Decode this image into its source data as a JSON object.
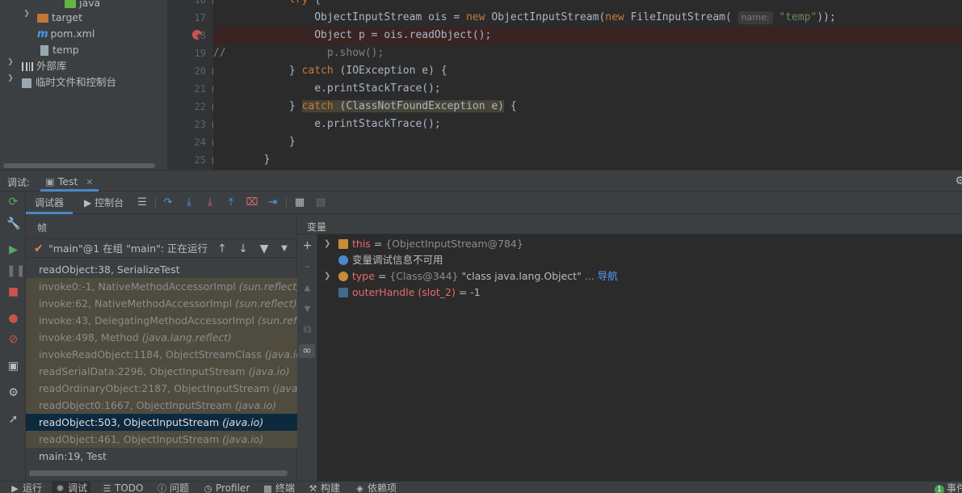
{
  "project_tree": {
    "items": [
      {
        "label": "java",
        "icon": "folder-green-icon"
      },
      {
        "label": "target",
        "icon": "folder-orange-icon"
      },
      {
        "label": "pom.xml",
        "icon": "maven-icon"
      },
      {
        "label": "temp",
        "icon": "file-icon"
      },
      {
        "label": "外部库",
        "icon": "library-icon"
      },
      {
        "label": "临时文件和控制台",
        "icon": "scratches-icon"
      }
    ]
  },
  "editor": {
    "line_numbers": [
      "16",
      "17",
      "18",
      "19",
      "20",
      "21",
      "22",
      "23",
      "24",
      "25"
    ],
    "lines": [
      {
        "parts": [
          {
            "t": "            "
          },
          {
            "t": "try",
            "c": "kw"
          },
          {
            "t": " {"
          }
        ]
      },
      {
        "parts": [
          {
            "t": "                ObjectInputStream ois = "
          },
          {
            "t": "new",
            "c": "kw"
          },
          {
            "t": " ObjectInputStream("
          },
          {
            "t": "new",
            "c": "kw"
          },
          {
            "t": " FileInputStream( "
          },
          {
            "t": "name:",
            "c": "hint"
          },
          {
            "t": " "
          },
          {
            "t": "\"temp\"",
            "c": "str"
          },
          {
            "t": "));"
          }
        ]
      },
      {
        "parts": [
          {
            "t": "                Object p = ois.readObject();"
          }
        ]
      },
      {
        "parts": [
          {
            "t": "//",
            "c": "cmt"
          },
          {
            "t": "                p.show();",
            "c": "cmt"
          }
        ]
      },
      {
        "parts": [
          {
            "t": "            } "
          },
          {
            "t": "catch",
            "c": "kw"
          },
          {
            "t": " (IOException e) {"
          }
        ]
      },
      {
        "parts": [
          {
            "t": "                e.printStackTrace();"
          }
        ]
      },
      {
        "parts": [
          {
            "t": "            } "
          },
          {
            "t": "catch (ClassNotFoundException e)",
            "c": "sel-kw"
          },
          {
            "t": " {"
          }
        ]
      },
      {
        "parts": [
          {
            "t": "                e.printStackTrace();"
          }
        ]
      },
      {
        "parts": [
          {
            "t": "            }"
          }
        ]
      },
      {
        "parts": [
          {
            "t": "        }"
          }
        ]
      }
    ]
  },
  "debug": {
    "label": "调试:",
    "tab": "Test",
    "subtabs": {
      "debugger": "调试器",
      "console": "控制台"
    },
    "frames_title": "帧",
    "thread": "\"main\"@1 在组 \"main\": 正在运行",
    "frames": [
      {
        "method": "readObject:38, SerializeTest",
        "pkg": "",
        "kind": "user"
      },
      {
        "method": "invoke0:-1, NativeMethodAccessorImpl ",
        "pkg": "(sun.reflect)",
        "kind": "lib"
      },
      {
        "method": "invoke:62, NativeMethodAccessorImpl ",
        "pkg": "(sun.reflect)",
        "kind": "lib"
      },
      {
        "method": "invoke:43, DelegatingMethodAccessorImpl ",
        "pkg": "(sun.reflect)",
        "kind": "lib"
      },
      {
        "method": "invoke:498, Method ",
        "pkg": "(java.lang.reflect)",
        "kind": "lib"
      },
      {
        "method": "invokeReadObject:1184, ObjectStreamClass ",
        "pkg": "(java.io)",
        "kind": "lib"
      },
      {
        "method": "readSerialData:2296, ObjectInputStream ",
        "pkg": "(java.io)",
        "kind": "lib"
      },
      {
        "method": "readOrdinaryObject:2187, ObjectInputStream ",
        "pkg": "(java.io)",
        "kind": "lib"
      },
      {
        "method": "readObject0:1667, ObjectInputStream ",
        "pkg": "(java.io)",
        "kind": "lib"
      },
      {
        "method": "readObject:503, ObjectInputStream ",
        "pkg": "(java.io)",
        "kind": "selected"
      },
      {
        "method": "readObject:461, ObjectInputStream ",
        "pkg": "(java.io)",
        "kind": "lib"
      },
      {
        "method": "main:19, Test",
        "pkg": "",
        "kind": "user"
      }
    ],
    "vars_title": "变量",
    "variables": [
      {
        "chevron": true,
        "icon": "field-icon",
        "name": "this",
        "eq": " = ",
        "value": "{ObjectInputStream@784}",
        "extra": "",
        "nav": ""
      },
      {
        "chevron": false,
        "icon": "info-icon",
        "name": "",
        "eq": "",
        "value": "",
        "extra": "变量调试信息不可用",
        "nav": ""
      },
      {
        "chevron": true,
        "icon": "parameter-icon",
        "name": "type",
        "eq": " = ",
        "value": "{Class@344} ",
        "extra": "\"class java.lang.Object\"",
        "nav": " ... 导航"
      },
      {
        "chevron": false,
        "icon": "slot-icon",
        "name": "outerHandle (slot_2)",
        "eq": " = ",
        "value": "",
        "extra": "-1",
        "nav": ""
      }
    ]
  },
  "status_bar": {
    "items": [
      "运行",
      "调试",
      "TODO",
      "问题",
      "Profiler",
      "终端",
      "构建",
      "依赖项"
    ],
    "event_count": "1",
    "event_label": "事件"
  },
  "colors": {
    "accent": "#4a88c7",
    "breakpoint": "#c75450",
    "keyword": "#cc7832",
    "string": "#6a8759"
  }
}
